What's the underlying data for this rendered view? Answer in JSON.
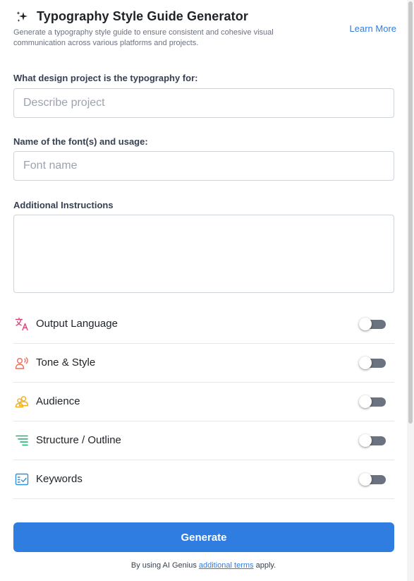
{
  "header": {
    "title": "Typography Style Guide Generator",
    "subtitle": "Generate a typography style guide to ensure consistent and cohesive visual communication across various platforms and projects.",
    "learn_more": "Learn More",
    "icon": "sparkles-icon"
  },
  "form": {
    "project": {
      "label": "What design project is the typography for:",
      "placeholder": "Describe project",
      "value": ""
    },
    "font": {
      "label": "Name of the font(s) and usage:",
      "placeholder": "Font name",
      "value": ""
    },
    "instructions": {
      "label": "Additional Instructions",
      "value": ""
    }
  },
  "options": [
    {
      "label": "Output Language",
      "icon": "translate-icon",
      "color": "#e0467c",
      "enabled": false
    },
    {
      "label": "Tone & Style",
      "icon": "voice-icon",
      "color": "#ef6b5b",
      "enabled": false
    },
    {
      "label": "Audience",
      "icon": "audience-icon",
      "color": "#f2b01e",
      "enabled": false
    },
    {
      "label": "Structure / Outline",
      "icon": "outline-icon",
      "color": "#22b573",
      "enabled": false
    },
    {
      "label": "Keywords",
      "icon": "keywords-icon",
      "color": "#2f8fd8",
      "enabled": false
    }
  ],
  "actions": {
    "generate": "Generate"
  },
  "footer": {
    "prefix": "By using AI Genius ",
    "link": "additional terms",
    "suffix": " apply."
  },
  "colors": {
    "accent": "#2f7de1",
    "toggle_off": "#6b7280"
  }
}
